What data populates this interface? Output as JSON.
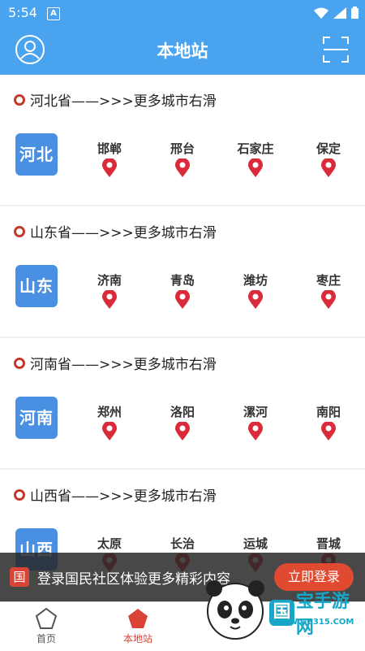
{
  "status": {
    "time": "5:54",
    "badge": "A"
  },
  "header": {
    "title": "本地站"
  },
  "sections": [
    {
      "title": "河北省——>>>更多城市右滑",
      "badge": "河北",
      "cities": [
        "邯郸",
        "邢台",
        "石家庄",
        "保定"
      ]
    },
    {
      "title": "山东省——>>>更多城市右滑",
      "badge": "山东",
      "cities": [
        "济南",
        "青岛",
        "潍坊",
        "枣庄"
      ]
    },
    {
      "title": "河南省——>>>更多城市右滑",
      "badge": "河南",
      "cities": [
        "郑州",
        "洛阳",
        "漯河",
        "南阳"
      ]
    },
    {
      "title": "山西省——>>>更多城市右滑",
      "badge": "山西",
      "cities": [
        "太原",
        "长治",
        "运城",
        "晋城"
      ]
    }
  ],
  "login_banner": {
    "logo": "国",
    "text": "登录国民社区体验更多精彩内容",
    "button": "立即登录"
  },
  "tabs": [
    {
      "label": "首页"
    },
    {
      "label": "本地站"
    }
  ],
  "watermark": {
    "brand_first": "国",
    "brand_rest": "宝手游网",
    "url": "WWW.GB315.COM"
  },
  "colors": {
    "accent": "#4aa3ee",
    "pin": "#d92b3a",
    "active_tab": "#d94437"
  }
}
